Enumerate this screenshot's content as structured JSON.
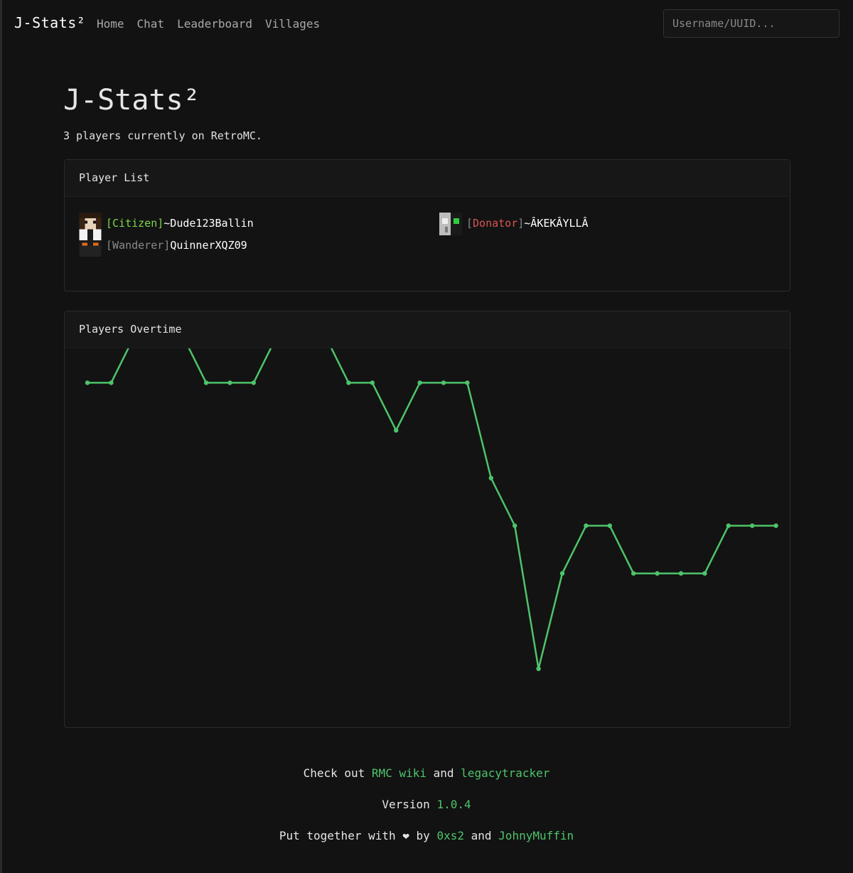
{
  "nav": {
    "brand": "J-Stats²",
    "links": [
      "Home",
      "Chat",
      "Leaderboard",
      "Villages"
    ],
    "search_placeholder": "Username/UUID..."
  },
  "header": {
    "title": "J-Stats²",
    "subtitle": "3 players currently on RetroMC."
  },
  "player_list": {
    "title": "Player List",
    "players": [
      {
        "rank": "Citizen",
        "rank_color": "#7bd84c",
        "name": "~Dude123Ballin"
      },
      {
        "rank": "Wanderer",
        "rank_color": "#8a8a8a",
        "name": "QuinnerXQZ09"
      },
      {
        "rank": "Donator",
        "rank_color": "#d9534f",
        "name": "~ÂKEKÂYLLÂ"
      }
    ]
  },
  "chart_card": {
    "title": "Players Overtime"
  },
  "chart_data": {
    "type": "line",
    "color": "#4ec46a",
    "grid": false,
    "y_range": [
      0,
      10
    ],
    "values": [
      7,
      7,
      8,
      8,
      8,
      7,
      7,
      7,
      8,
      8,
      8,
      7,
      7,
      6,
      7,
      7,
      7,
      5,
      4,
      1,
      3,
      4,
      4,
      3,
      3,
      3,
      3,
      4,
      4,
      4
    ]
  },
  "footer": {
    "check_out": "Check out",
    "rmc_wiki": "RMC wiki",
    "and1": "and",
    "legacytracker": "legacytracker",
    "version_label": "Version",
    "version": "1.0.4",
    "put_together": "Put together with",
    "heart": "❤",
    "by": "by",
    "author1": "0xs2",
    "and2": "and",
    "author2": "JohnyMuffin"
  }
}
